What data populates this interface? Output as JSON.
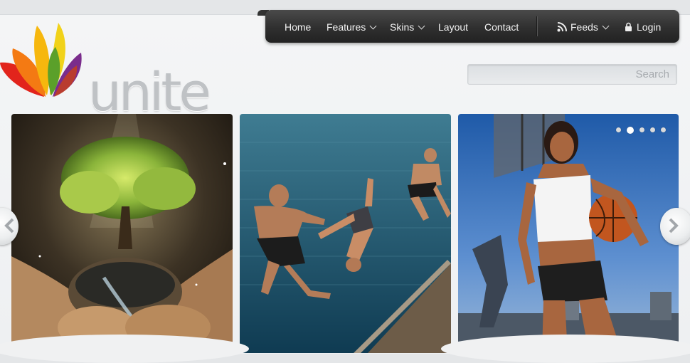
{
  "brand": {
    "name": "unite"
  },
  "nav": {
    "items": [
      {
        "label": "Home",
        "has_dropdown": false
      },
      {
        "label": "Features",
        "has_dropdown": true
      },
      {
        "label": "Skins",
        "has_dropdown": true
      },
      {
        "label": "Layout",
        "has_dropdown": false
      },
      {
        "label": "Contact",
        "has_dropdown": false
      }
    ],
    "feeds_label": "Feeds",
    "login_label": "Login"
  },
  "search": {
    "placeholder": "Search",
    "value": ""
  },
  "slider": {
    "slides": [
      {
        "subject": "hands holding tree"
      },
      {
        "subject": "men jumping into sea"
      },
      {
        "subject": "basketball player"
      }
    ],
    "dot_count": 5,
    "active_dot": 2
  },
  "icons": {
    "feeds": "rss-icon",
    "login": "lock-icon",
    "dropdown": "chevron-down-icon",
    "prev": "chevron-left-icon",
    "next": "chevron-right-icon"
  },
  "colors": {
    "nav_bg": "#2f2f2f",
    "nav_text": "#f2f2f2",
    "logo_text": "#bfc2c5",
    "page_bg": "#f1f2f4"
  }
}
